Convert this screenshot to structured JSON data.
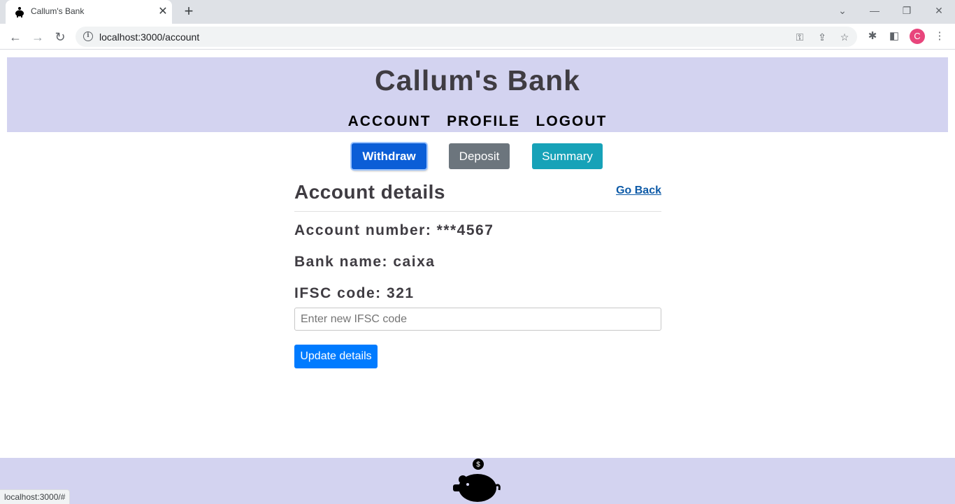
{
  "browser": {
    "tab_title": "Callum's Bank",
    "tab_close": "✕",
    "new_tab": "+",
    "url": "localhost:3000/account",
    "status_url": "localhost:3000/#",
    "profile_initial": "C"
  },
  "header": {
    "site_title": "Callum's Bank",
    "nav": [
      "ACCOUNT",
      "PROFILE",
      "LOGOUT"
    ]
  },
  "actions": {
    "withdraw": "Withdraw",
    "deposit": "Deposit",
    "summary": "Summary"
  },
  "account": {
    "title": "Account details",
    "go_back": "Go Back",
    "account_number": "Account number: ***4567",
    "bank_name": "Bank name: caixa",
    "ifsc_code": "IFSC code: 321",
    "ifsc_placeholder": "Enter new IFSC code",
    "update_button": "Update details"
  },
  "footer": {
    "logo_symbol": "$"
  },
  "colors": {
    "header_bg": "#d3d3f0",
    "withdraw": "#0b5ed7",
    "deposit": "#6c757d",
    "summary": "#17a2b8",
    "update": "#007bff"
  }
}
